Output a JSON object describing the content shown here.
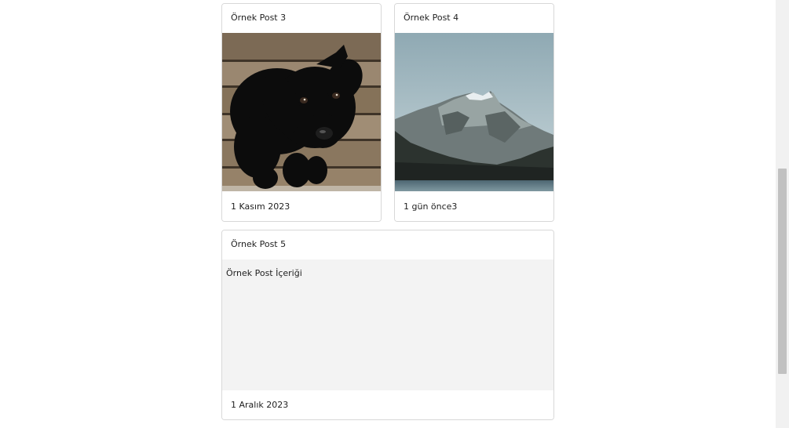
{
  "posts": [
    {
      "title": "Örnek Post 3",
      "date": "1 Kasım 2023",
      "image": "black-puppy-on-wooden-deck"
    },
    {
      "title": "Örnek Post 4",
      "date": "1 gün önce3",
      "image": "snowy-mountain-lake"
    },
    {
      "title": "Örnek Post 5",
      "content": "Örnek Post İçeriği",
      "date": "1 Aralık 2023"
    }
  ],
  "colors": {
    "card_border": "#d8d8d8",
    "content_bg": "#f3f3f3",
    "scroll_track": "#f1f1f1",
    "scroll_thumb": "#c1c1c1"
  }
}
